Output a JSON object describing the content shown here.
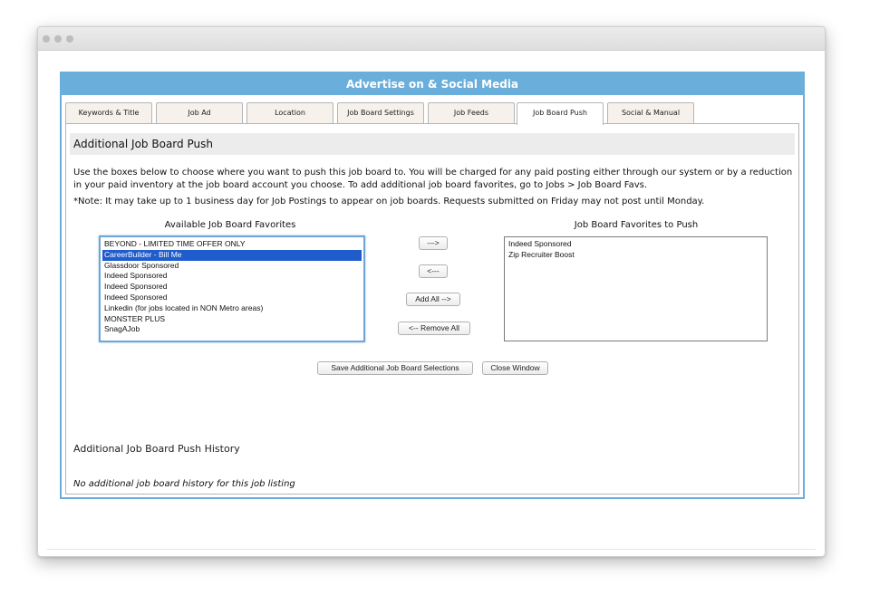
{
  "panel": {
    "title": "Advertise on & Social Media"
  },
  "tabs": [
    {
      "label": "Keywords & Title",
      "active": false
    },
    {
      "label": "Job Ad",
      "active": false
    },
    {
      "label": "Location",
      "active": false
    },
    {
      "label": "Job Board Settings",
      "active": false
    },
    {
      "label": "Job Feeds",
      "active": false
    },
    {
      "label": "Job Board Push",
      "active": true
    },
    {
      "label": "Social & Manual",
      "active": false
    }
  ],
  "section": {
    "title": "Additional Job Board Push",
    "description": "Use the boxes below to choose where you want to push this job board to. You will be charged for any paid posting either through our system or by a reduction in your paid inventory at the job board account you choose. To add additional job board favorites, go to Jobs > Job Board Favs.",
    "note": "*Note: It may take up to 1 business day for Job Postings to appear on job boards. Requests submitted on Friday may not post until Monday."
  },
  "available": {
    "label": "Available Job Board Favorites",
    "items": [
      {
        "label": "BEYOND - LIMITED TIME OFFER ONLY",
        "selected": false
      },
      {
        "label": "CareerBuilder - Bill Me",
        "selected": true
      },
      {
        "label": "Glassdoor Sponsored",
        "selected": false
      },
      {
        "label": "Indeed Sponsored",
        "selected": false
      },
      {
        "label": "Indeed Sponsored",
        "selected": false
      },
      {
        "label": "Indeed Sponsored",
        "selected": false
      },
      {
        "label": "Linkedin (for jobs located in NON Metro areas)",
        "selected": false
      },
      {
        "label": "MONSTER PLUS",
        "selected": false
      },
      {
        "label": "SnagAJob",
        "selected": false
      }
    ]
  },
  "push": {
    "label": "Job Board Favorites to Push",
    "items": [
      {
        "label": "Indeed Sponsored"
      },
      {
        "label": "Zip Recruiter Boost"
      }
    ]
  },
  "buttons": {
    "move_right": "--->",
    "move_left": "<---",
    "add_all": "Add All -->",
    "remove_all": "<-- Remove All",
    "save": "Save Additional Job Board Selections",
    "close": "Close Window"
  },
  "history": {
    "title": "Additional Job Board Push History",
    "empty_text": "No additional job board history for this job listing"
  },
  "colors": {
    "accent": "#6aaedb",
    "selection": "#1f5ccc"
  }
}
